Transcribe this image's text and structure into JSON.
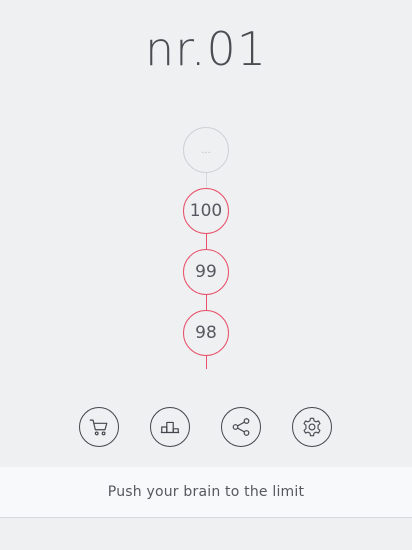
{
  "header": {
    "title": "nr.01"
  },
  "levels": [
    {
      "label": "...",
      "state": "locked"
    },
    {
      "label": "100",
      "state": "unlocked"
    },
    {
      "label": "99",
      "state": "unlocked"
    },
    {
      "label": "98",
      "state": "unlocked"
    }
  ],
  "toolbar": {
    "buttons": [
      {
        "icon": "cart-icon"
      },
      {
        "icon": "podium-icon"
      },
      {
        "icon": "share-icon"
      },
      {
        "icon": "gear-icon"
      }
    ]
  },
  "footer": {
    "tagline": "Push your brain to the limit"
  },
  "colors": {
    "accent": "#e8506a",
    "background": "#eef0f2",
    "text": "#4a4d52"
  }
}
